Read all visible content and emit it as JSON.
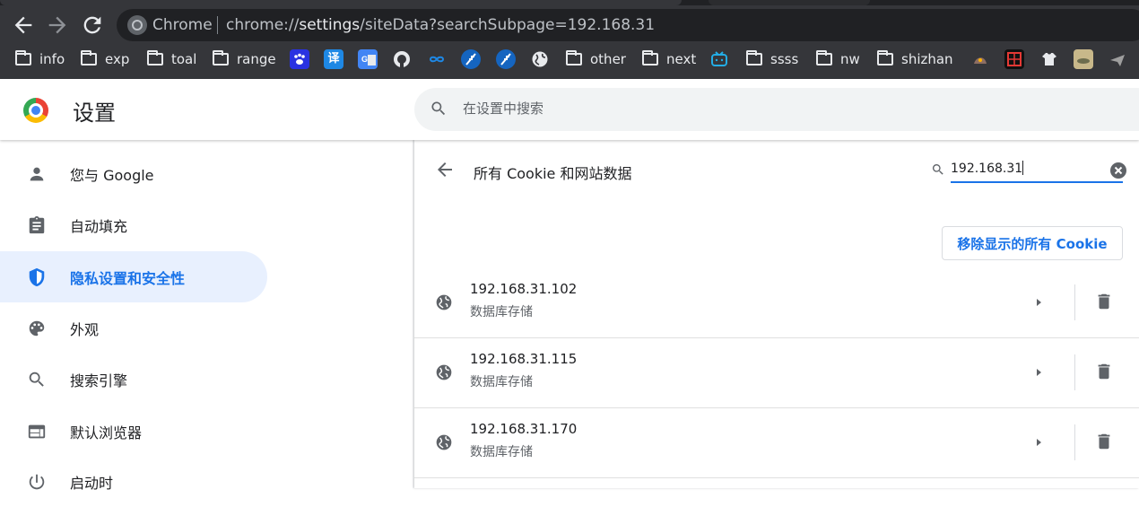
{
  "browser": {
    "brand": "Chrome",
    "url_prefix": "chrome://",
    "url_bold": "settings",
    "url_suffix": "/siteData?searchSubpage=192.168.31"
  },
  "bookmarks": {
    "folders": [
      "info",
      "exp",
      "toal",
      "range",
      "other",
      "next",
      "ssss",
      "nw",
      "shizhan"
    ],
    "translate_icon": "译"
  },
  "settings": {
    "title": "设置",
    "search_placeholder": "在设置中搜索"
  },
  "sidebar": {
    "items": [
      {
        "label": "您与 Google",
        "icon": "person-icon"
      },
      {
        "label": "自动填充",
        "icon": "clipboard-icon"
      },
      {
        "label": "隐私设置和安全性",
        "icon": "shield-icon"
      },
      {
        "label": "外观",
        "icon": "palette-icon"
      },
      {
        "label": "搜索引擎",
        "icon": "search-icon"
      },
      {
        "label": "默认浏览器",
        "icon": "browser-icon"
      },
      {
        "label": "启动时",
        "icon": "power-icon"
      }
    ]
  },
  "main": {
    "title": "所有 Cookie 和网站数据",
    "filter_value": "192.168.31",
    "remove_all_label": "移除显示的所有 Cookie",
    "sites": [
      {
        "host": "192.168.31.102",
        "type": "数据库存储"
      },
      {
        "host": "192.168.31.115",
        "type": "数据库存储"
      },
      {
        "host": "192.168.31.170",
        "type": "数据库存储"
      }
    ]
  },
  "colors": {
    "accent": "#1a73e8",
    "active_bg": "#e8f0fe",
    "topbar": "#35363a"
  }
}
